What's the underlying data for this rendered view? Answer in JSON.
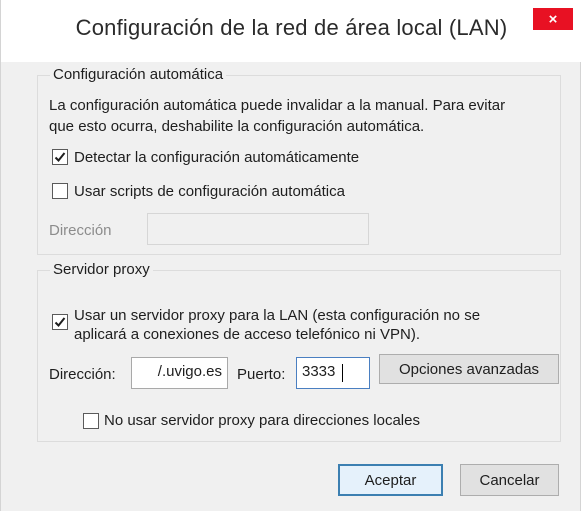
{
  "window": {
    "title": "Configuración de la red de área local (LAN)",
    "close_glyph": "×"
  },
  "auto_config": {
    "legend": "Configuración automática",
    "description_line1": "La configuración automática puede invalidar a la manual. Para evitar",
    "description_line2": "que esto ocurra, deshabilite la configuración automática.",
    "detect_label": "Detectar la configuración automáticamente",
    "detect_checked": true,
    "scripts_label": "Usar scripts de configuración automática",
    "scripts_checked": false,
    "address_label": "Dirección",
    "address_value": ""
  },
  "proxy": {
    "legend": "Servidor proxy",
    "use_proxy_label_line1": "Usar un servidor proxy para la LAN (esta configuración no se",
    "use_proxy_label_line2": "aplicará a conexiones de acceso telefónico ni VPN).",
    "use_proxy_checked": true,
    "address_label": "Dirección:",
    "address_value": "/.uvigo.es",
    "port_label": "Puerto:",
    "port_value": "3333",
    "advanced_button": "Opciones avanzadas",
    "bypass_local_label": "No usar servidor proxy para direcciones locales",
    "bypass_local_checked": false
  },
  "buttons": {
    "ok": "Aceptar",
    "cancel": "Cancelar"
  },
  "colors": {
    "close": "#e81123",
    "default_button_border": "#3c7fb1",
    "dialog_bg": "#f0f0f0"
  }
}
